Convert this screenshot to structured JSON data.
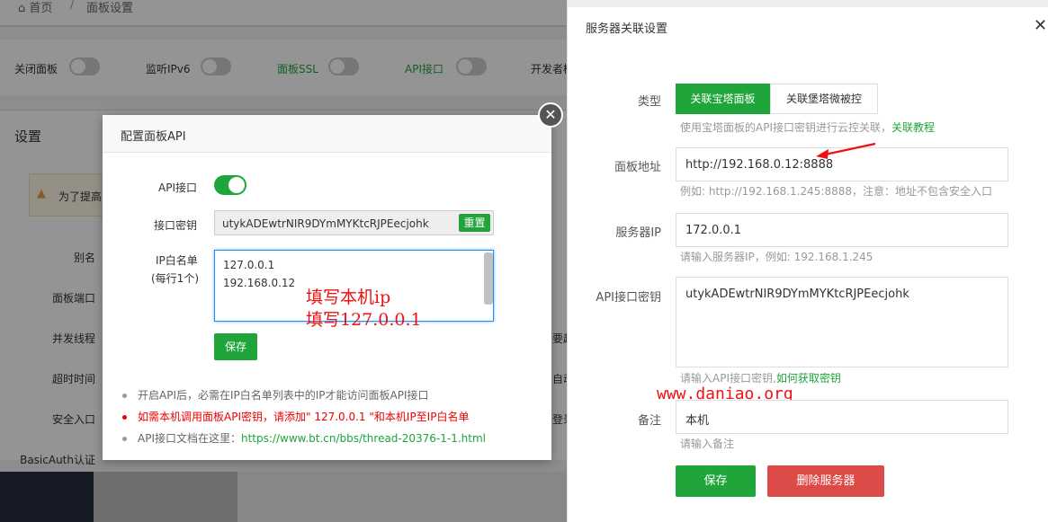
{
  "breadcrumb": {
    "home": "首页",
    "separator": "/",
    "current": "面板设置"
  },
  "toggles": [
    {
      "label": "关闭面板"
    },
    {
      "label": "监听IPv6"
    },
    {
      "label": "面板SSL"
    },
    {
      "label": "API接口"
    },
    {
      "label": "开发者模"
    }
  ],
  "settings": {
    "title": "设置",
    "alert_text": "为了提高",
    "rows": [
      {
        "label": "别名"
      },
      {
        "label": "面板端口"
      },
      {
        "label": "并发线程",
        "tail": "要超"
      },
      {
        "label": "超时时间",
        "tail": "自动"
      },
      {
        "label": "安全入口",
        "tail": "登录"
      },
      {
        "label": "BasicAuth认证"
      }
    ]
  },
  "api_dialog": {
    "title": "配置面板API",
    "close_symbol": "✕",
    "api_label": "API接口",
    "api_enabled": true,
    "key_label": "接口密钥",
    "key_value": "utykADEwtrNIR9DYmMYKtcRJPEecjohk",
    "reset_label": "重置",
    "ip_label": "IP白名单",
    "ip_sublabel": "(每行1个)",
    "ip_lines": [
      "127.0.0.1",
      "192.168.0.12"
    ],
    "save_label": "保存",
    "notes": [
      {
        "text": "开启API后，必需在IP白名单列表中的IP才能访问面板API接口"
      },
      {
        "text": "如需本机调用面板API密钥，请添加\" 127.0.0.1 \"和本机IP至IP白名单"
      },
      {
        "prefix": "API接口文档在这里：",
        "link": "https://www.bt.cn/bbs/thread-20376-1-1.html"
      }
    ],
    "annotation_1": "填写本机ip",
    "annotation_2": "填写127.0.0.1"
  },
  "drawer": {
    "title": "服务器关联设置",
    "close_symbol": "✕",
    "type_label": "类型",
    "tab_active": "关联宝塔面板",
    "tab_inactive": "关联堡塔微被控",
    "type_hint_prefix": "使用宝塔面板的API接口密钥进行云控关联，",
    "type_hint_link": "关联教程",
    "url_label": "面板地址",
    "url_value": "http://192.168.0.12:8888",
    "url_hint": "例如: http://192.168.1.245:8888，注意：地址不包含安全入口",
    "ip_label": "服务器IP",
    "ip_value": "172.0.0.1",
    "ip_hint": "请输入服务器IP，例如: 192.168.1.245",
    "key_label": "API接口密钥",
    "key_value": "utykADEwtrNIR9DYmMYKtcRJPEecjohk",
    "key_hint_prefix": "请输入API接口密钥,",
    "key_hint_link": "如何获取密钥",
    "note_label": "备注",
    "note_value": "本机",
    "note_hint": "请输入备注",
    "save_label": "保存",
    "delete_label": "删除服务器",
    "watermark": "www.daniao.org"
  },
  "colors": {
    "accent": "#20a53a",
    "danger": "#dd4b48",
    "annotation": "#e11111"
  }
}
